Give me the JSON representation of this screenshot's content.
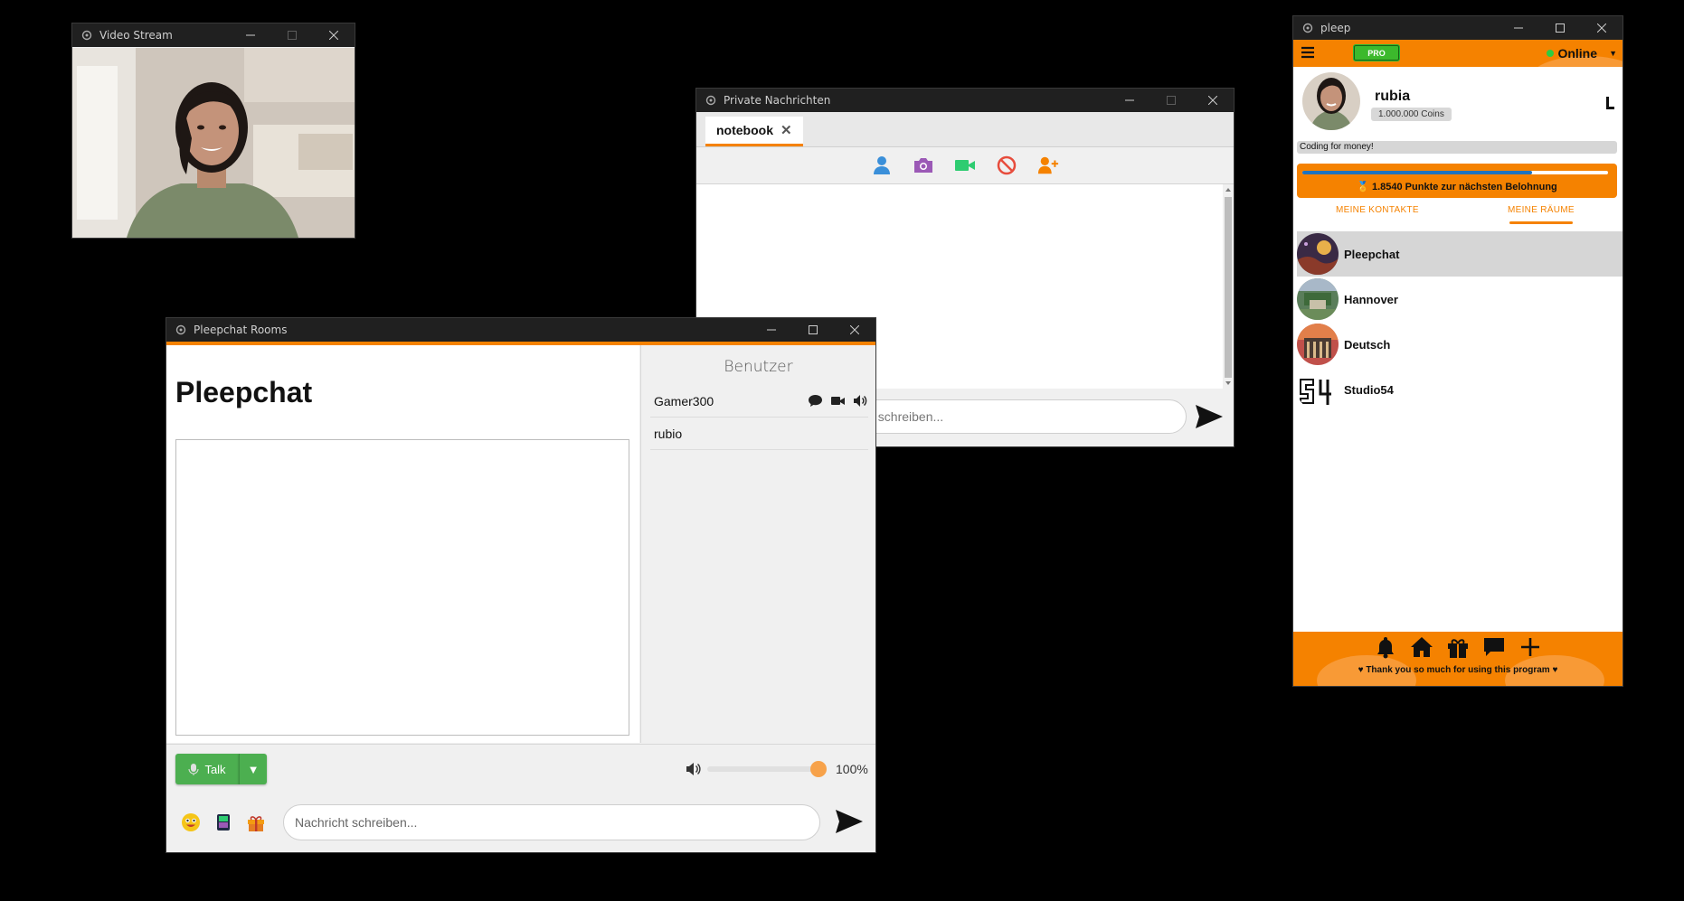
{
  "video_window": {
    "title": "Video Stream"
  },
  "pm_window": {
    "title": "Private Nachrichten",
    "tab_label": "notebook",
    "tab_close": "✕",
    "input_placeholder": "Nachricht schreiben...",
    "input_visible": "t schreiben..."
  },
  "rooms_window": {
    "title": "Pleepchat Rooms",
    "room_name": "Pleepchat",
    "users_header": "Benutzer",
    "users": [
      {
        "name": "Gamer300"
      },
      {
        "name": "rubio"
      }
    ],
    "talk_label": "Talk",
    "talk_dropdown": "▼",
    "volume_text": "100%",
    "volume_level": 1.0,
    "input_placeholder": "Nachricht schreiben..."
  },
  "pleep_window": {
    "title": "pleep",
    "pro_badge": "PRO",
    "status": "Online",
    "status_dropdown": "▼",
    "username": "rubia",
    "coins": "1.000.000 Coins",
    "status_message": "Coding for money!",
    "reward_text": "1.8540 Punkte zur nächsten Belohnung",
    "reward_progress": 0.75,
    "tab_contacts": "MEINE KONTAKTE",
    "tab_rooms": "MEINE RÄUME",
    "rooms": [
      {
        "name": "Pleepchat"
      },
      {
        "name": "Hannover"
      },
      {
        "name": "Deutsch"
      },
      {
        "name": "Studio54"
      }
    ],
    "footer_text": "♥ Thank you so much for using this program ♥"
  },
  "colors": {
    "accent": "#f58200",
    "green": "#4caf50",
    "online": "#2ecc40"
  }
}
